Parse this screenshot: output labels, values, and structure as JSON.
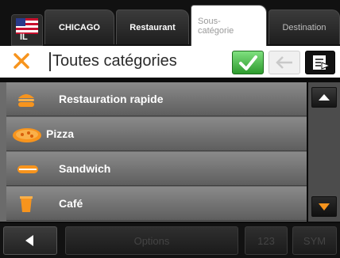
{
  "tabs": {
    "state_abbrev": "IL",
    "city": "CHICAGO",
    "category": "Restaurant",
    "subcategory_line1": "Sous-",
    "subcategory_line2": "catégorie",
    "destination": "Destination"
  },
  "search": {
    "value": "Toutes catégories"
  },
  "list": {
    "items": [
      {
        "label": "Restauration rapide",
        "icon": "burger-icon"
      },
      {
        "label": "Pizza",
        "icon": "pizza-icon"
      },
      {
        "label": "Sandwich",
        "icon": "sandwich-icon"
      },
      {
        "label": "Café",
        "icon": "coffee-cup-icon"
      }
    ]
  },
  "bottom": {
    "options_label": "Options",
    "num_label": "123",
    "sym_label": "SYM"
  },
  "colors": {
    "accent_orange": "#f7941d",
    "ok_green": "#3cb043"
  }
}
